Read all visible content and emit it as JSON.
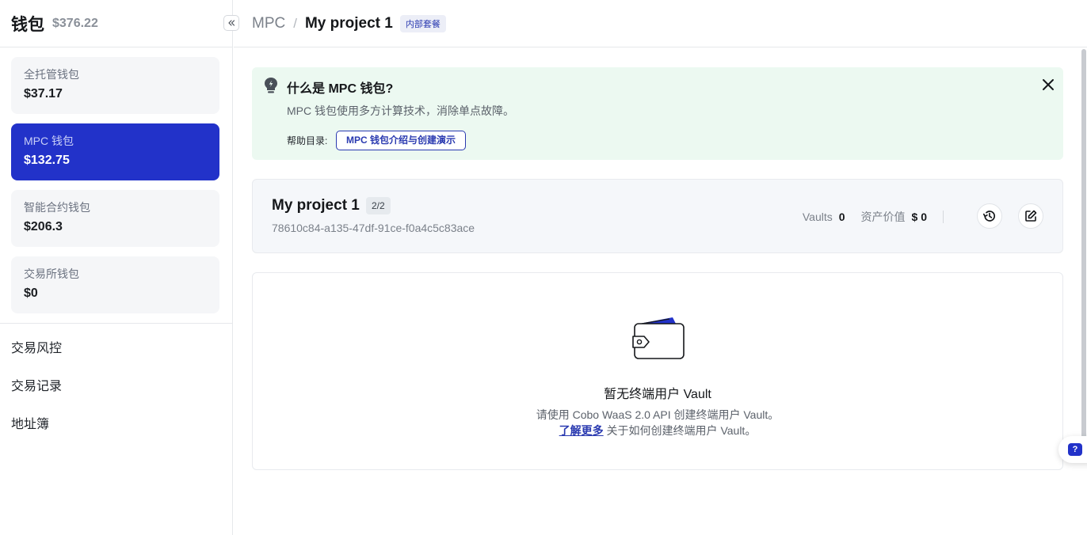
{
  "sidebar": {
    "title": "钱包",
    "total": "$376.22",
    "wallets": [
      {
        "name": "全托管钱包",
        "value": "$37.17",
        "active": false
      },
      {
        "name": "MPC 钱包",
        "value": "$132.75",
        "active": true
      },
      {
        "name": "智能合约钱包",
        "value": "$206.3",
        "active": false
      },
      {
        "name": "交易所钱包",
        "value": "$0",
        "active": false
      }
    ],
    "nav": [
      "交易风控",
      "交易记录",
      "地址簿"
    ]
  },
  "breadcrumb": {
    "root": "MPC",
    "separator": "/",
    "current": "My project 1",
    "badge": "内部套餐"
  },
  "banner": {
    "title": "什么是 MPC 钱包?",
    "description": "MPC 钱包使用多方计算技术，消除单点故障。",
    "help_label": "帮助目录:",
    "help_link": "MPC 钱包介绍与创建演示"
  },
  "project": {
    "name": "My project 1",
    "count": "2/2",
    "id": "78610c84-a135-47df-91ce-f0a4c5c83ace",
    "vaults_label": "Vaults",
    "vaults_value": "0",
    "asset_label": "资产价值",
    "asset_value": "$ 0"
  },
  "empty": {
    "title": "暂无终端用户 Vault",
    "description": "请使用 Cobo WaaS 2.0 API 创建终端用户 Vault。",
    "learn_more": "了解更多",
    "learn_more_suffix": " 关于如何创建终端用户 Vault。"
  },
  "help_fab": {
    "label": "?"
  },
  "colors": {
    "accent": "#2232c9",
    "banner_bg": "#ecf9f1",
    "card_bg": "#f5f7fa"
  },
  "icons": [
    "collapse-icon",
    "bulb-icon",
    "close-icon",
    "history-icon",
    "edit-icon",
    "wallet-illustration",
    "help-icon"
  ]
}
